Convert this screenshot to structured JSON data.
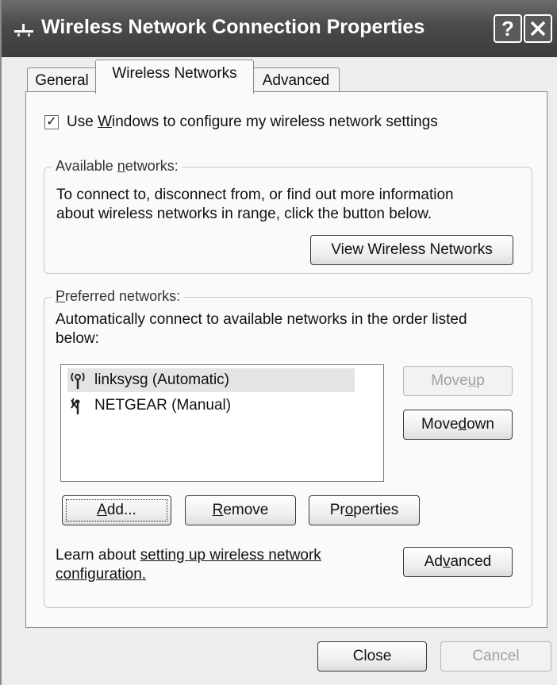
{
  "window": {
    "title": "Wireless Network Connection Properties",
    "help_button": "?",
    "close_button": "X"
  },
  "tabs": [
    {
      "label": "General",
      "active": false
    },
    {
      "label": "Wireless Networks",
      "active": true
    },
    {
      "label": "Advanced",
      "active": false
    }
  ],
  "use_windows": {
    "checked": true,
    "check_mark": "✓",
    "label_pre": "Use ",
    "label_u": "W",
    "label_post": "indows to configure my wireless network settings"
  },
  "available": {
    "legend_pre": "Available ",
    "legend_u": "n",
    "legend_post": "etworks:",
    "line1": "To connect to, disconnect from, or find out more information",
    "line2": "about wireless networks in range, click the button below.",
    "view_button": "View Wireless Networks"
  },
  "preferred": {
    "legend_u": "P",
    "legend_post": "referred networks:",
    "line1": "Automatically connect to available networks in the order listed",
    "line2": "below:",
    "networks": [
      {
        "name": "linksysg (Automatic)",
        "icon": "wireless-antenna-icon",
        "selected": true
      },
      {
        "name": "NETGEAR (Manual)",
        "icon": "wireless-antenna-disabled-icon",
        "selected": false
      }
    ],
    "move_up": {
      "pre": "Move ",
      "u": "u",
      "post": "p",
      "enabled": false
    },
    "move_down": {
      "pre": "Move ",
      "u": "d",
      "post": "own",
      "enabled": true
    },
    "add": {
      "u": "A",
      "post": "dd..."
    },
    "remove": {
      "u": "R",
      "post": "emove"
    },
    "properties": {
      "pre": "Pr",
      "u": "o",
      "post": "perties"
    },
    "learn_pre": "Learn about ",
    "learn_link1": "setting up wireless network",
    "learn_link2": "configuration.",
    "advanced": {
      "pre": "Ad",
      "u": "v",
      "post": "anced"
    }
  },
  "footer": {
    "close": "Close",
    "cancel": "Cancel"
  },
  "colors": {
    "titlebar": "#4a4a4a",
    "dialog_bg": "#ededed",
    "panel_bg": "#fafafa",
    "disabled_text": "#a0a0a0"
  }
}
